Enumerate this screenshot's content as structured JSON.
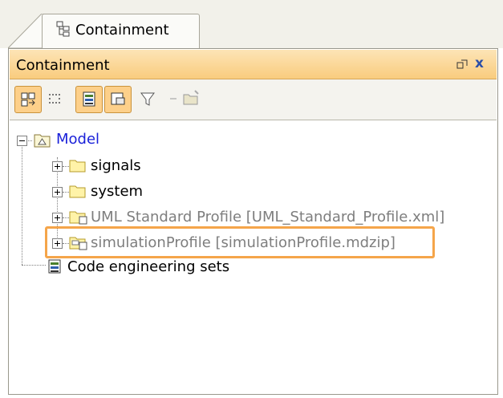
{
  "tab": {
    "label": "Containment",
    "icon": "containment-tree-icon"
  },
  "panel": {
    "title": "Containment",
    "controls": {
      "restore_icon": "restore-icon",
      "close_label": "x"
    },
    "accent": "#f9cc7e",
    "highlight_color": "#f5a54a"
  },
  "toolbar": {
    "buttons": [
      {
        "icon": "group-icon",
        "active": true
      },
      {
        "icon": "dotted-grid-icon",
        "active": false
      },
      {
        "icon": "model-browser-icon",
        "active": true
      },
      {
        "icon": "show-elements-icon",
        "active": true
      },
      {
        "icon": "filter-icon",
        "active": false
      },
      {
        "icon": "open-folder-icon",
        "active": false
      }
    ]
  },
  "tree": {
    "root": {
      "label": "Model",
      "icon": "model-package-icon",
      "expanded": true
    },
    "children": [
      {
        "label": "signals",
        "icon": "folder-icon"
      },
      {
        "label": "system",
        "icon": "folder-icon"
      },
      {
        "label": "UML Standard Profile [UML_Standard_Profile.xml]",
        "icon": "profile-folder-icon"
      },
      {
        "label": "simulationProfile [simulationProfile.mdzip]",
        "icon": "profile-folder-icon",
        "highlighted": true
      }
    ],
    "code_sets": {
      "label": "Code engineering sets",
      "icon": "code-engineering-icon"
    }
  }
}
